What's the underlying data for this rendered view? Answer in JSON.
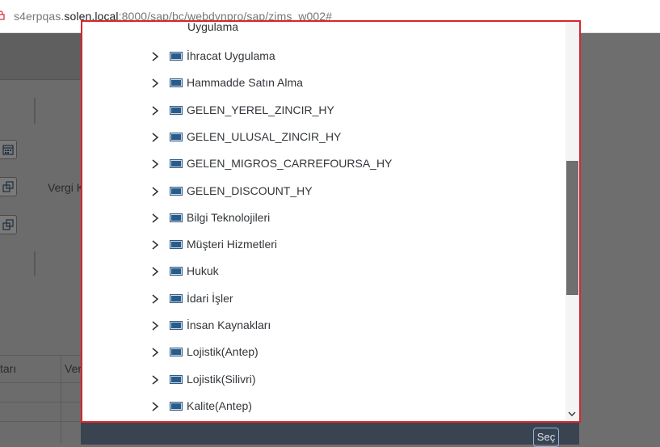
{
  "browser": {
    "url_prefix": "s4erpqas.",
    "url_host": "solen.local",
    "url_rest": ":8000/sap/bc/webdynpro/sap/zims_w002#"
  },
  "background": {
    "label_vergi": "Vergi K",
    "table_col1": "tarı",
    "table_col2": "Ver",
    "footer_button": "Seç"
  },
  "dialog": {
    "partial_top_item": "Uygulama",
    "tree_items": [
      {
        "label": "İhracat Uygulama"
      },
      {
        "label": "Hammadde Satın Alma"
      },
      {
        "label": "GELEN_YEREL_ZINCIR_HY"
      },
      {
        "label": "GELEN_ULUSAL_ZINCIR_HY"
      },
      {
        "label": "GELEN_MIGROS_CARREFOURSA_HY"
      },
      {
        "label": "GELEN_DISCOUNT_HY"
      },
      {
        "label": "Bilgi Teknolojileri"
      },
      {
        "label": "Müşteri Hizmetleri"
      },
      {
        "label": "Hukuk"
      },
      {
        "label": "İdari İşler"
      },
      {
        "label": "İnsan Kaynakları"
      },
      {
        "label": "Lojistik(Antep)"
      },
      {
        "label": "Lojistik(Silivri)"
      },
      {
        "label": "Kalite(Antep)"
      }
    ]
  },
  "icons": {
    "expand": "chevron-right-icon",
    "node": "folder-node-icon"
  },
  "colors": {
    "highlight_border": "#d9252b",
    "node_icon": "#2a5c8a",
    "overlay": "#6c6c6c"
  }
}
